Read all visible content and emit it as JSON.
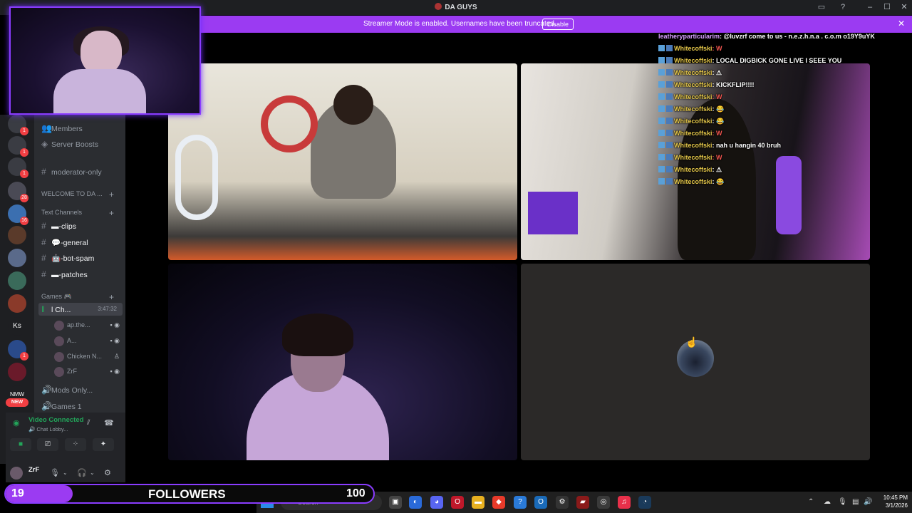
{
  "window": {
    "title": "DA GUYS"
  },
  "banner": {
    "message": "Streamer Mode is enabled. Usernames have been truncated.",
    "disable_label": "Disable"
  },
  "server_rail": {
    "badges": [
      "1",
      "1",
      "1",
      "1",
      "28",
      "16",
      "1",
      "1"
    ],
    "ks_label": "Ks",
    "nmw_label": "NMW",
    "new_label": "NEW"
  },
  "sidebar": {
    "members": "Members",
    "server_boosts": "Server Boosts",
    "moderator_only": "moderator-only",
    "welcome_category": "WELCOME TO DA ...",
    "text_category": "Text Channels",
    "channels": [
      "▬-clips",
      "💬-general",
      "🤖-bot-spam",
      "▬-patches"
    ],
    "games_category": "Games 🎮",
    "active_voice": "l Ch...",
    "active_timer": "3:47:32",
    "voice_members": [
      "ap.the...",
      "A...",
      "Chicken N...",
      "ZrF"
    ],
    "mods_only": "Mods Only...",
    "games1": "Games 1"
  },
  "voice_panel": {
    "status": "Video Connected",
    "sub": "🔊 Chat Lobby..."
  },
  "user": {
    "name": "ZrF"
  },
  "chat": [
    {
      "user": "leatheryparticularim",
      "message": ": @luvzrf come to us - n.e.z.h.n.a . c.o.m o19Y9uYK",
      "badge": false
    },
    {
      "user": "Whitecoffski",
      "message": ": W",
      "badge": true
    },
    {
      "user": "Whitecoffski",
      "message": ": LOCAL DIGBICK GONE LIVE I SEEE YOU",
      "badge": true
    },
    {
      "user": "Whitecoffski",
      "message": ": ⚠",
      "badge": true
    },
    {
      "user": "Whitecoffski",
      "message": ": KICKFLIP!!!!",
      "badge": true
    },
    {
      "user": "Whitecoffski",
      "message": ": W",
      "badge": true
    },
    {
      "user": "Whitecoffski",
      "message": ": 😂",
      "badge": true
    },
    {
      "user": "Whitecoffski",
      "message": ": 😂",
      "badge": true
    },
    {
      "user": "Whitecoffski",
      "message": ": W",
      "badge": true
    },
    {
      "user": "Whitecoffski",
      "message": ": nah u hangin 40 bruh",
      "badge": true
    },
    {
      "user": "Whitecoffski",
      "message": ": W",
      "badge": true
    },
    {
      "user": "Whitecoffski",
      "message": ": ⚠",
      "badge": true
    },
    {
      "user": "Whitecoffski",
      "message": ": 😂",
      "badge": true
    }
  ],
  "followers": {
    "count": "19",
    "label": "FOLLOWERS",
    "goal": "100"
  },
  "taskbar": {
    "search_placeholder": "Search",
    "time": "10:45 PM",
    "date": "3/1/2026"
  },
  "colors": {
    "accent": "#9b3bf2",
    "voice_green": "#23a55a",
    "badge_red": "#f23f43"
  }
}
